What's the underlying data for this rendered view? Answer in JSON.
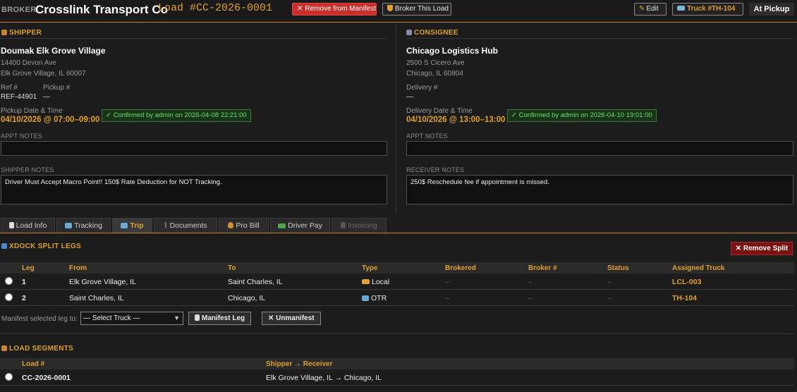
{
  "header": {
    "broker_tag": "BROKER",
    "company": "Crosslink Transport Co",
    "load_id": "Load #CC-2026-0001",
    "remove_manifest_label": "Remove from Manifest",
    "broker_load_label": "Broker This Load",
    "edit_label": "Edit",
    "truck_label": "Truck #TH-104",
    "status": "At Pickup"
  },
  "shipper": {
    "heading": "SHIPPER",
    "name": "Doumak Elk Grove Village",
    "address1": "14400 Devon Ave",
    "address2": "Elk Grove Village, IL 60007",
    "ref_label": "Ref #",
    "ref_value": "REF-44901",
    "pickup_label": "Pickup #",
    "pickup_value": "—",
    "date_label": "Pickup Date & Time",
    "date_value": "04/10/2026 @ 07:00–09:00",
    "confirmed": "✓ Confirmed by admin on 2026-04-08 22:21:00",
    "appt_notes_label": "APPT NOTES",
    "appt_notes": "",
    "notes_label": "SHIPPER NOTES",
    "notes": "Driver Must Accept Macro Point!! 150$ Rate Deduction for NOT Tracking."
  },
  "consignee": {
    "heading": "CONSIGNEE",
    "name": "Chicago Logistics Hub",
    "address1": "2500 S Cicero Ave",
    "address2": "Chicago, IL 60804",
    "delivery_label": "Delivery #",
    "delivery_value": "—",
    "date_label": "Delivery Date & Time",
    "date_value": "04/10/2026 @ 13:00–13:00",
    "confirmed": "✓ Confirmed by admin on 2026-04-10 19:01:00",
    "appt_notes_label": "APPT NOTES",
    "appt_notes": "",
    "notes_label": "RECEIVER NOTES",
    "notes": "250$ Reschedule fee if appointment is missed."
  },
  "tabs": [
    {
      "label": "Load Info",
      "icon": "clipboard-icon"
    },
    {
      "label": "Tracking",
      "icon": "map-icon"
    },
    {
      "label": "Trip",
      "icon": "trip-icon",
      "active": true
    },
    {
      "label": "Documents",
      "icon": "paperclip-icon"
    },
    {
      "label": "Pro Bill",
      "icon": "money-bag-icon"
    },
    {
      "label": "Driver Pay",
      "icon": "cash-icon"
    },
    {
      "label": "Invoicing",
      "icon": "invoice-icon",
      "disabled": true
    }
  ],
  "xdock": {
    "title": "XDOCK SPLIT LEGS",
    "remove_split_label": "✕ Remove Split",
    "columns": [
      "Leg",
      "From",
      "To",
      "Type",
      "Brokered",
      "Broker #",
      "Status",
      "Assigned Truck"
    ],
    "legs": [
      {
        "leg": "1",
        "from": "Elk Grove Village, IL",
        "to": "Saint Charles, IL",
        "type": "Local",
        "type_icon": "truck-icon",
        "brokered": "–",
        "broker_no": "–",
        "status": "–",
        "truck": "LCL-003"
      },
      {
        "leg": "2",
        "from": "Saint Charles, IL",
        "to": "Chicago, IL",
        "type": "OTR",
        "type_icon": "map-icon",
        "brokered": "–",
        "broker_no": "–",
        "status": "–",
        "truck": "TH-104"
      }
    ],
    "manifest_label": "Manifest selected leg to:",
    "select_value": "— Select Truck —",
    "manifest_leg_label": "Manifest Leg",
    "unmanifest_label": "✕ Unmanifest"
  },
  "segments": {
    "title": "LOAD SEGMENTS",
    "columns": [
      "Load #",
      "Shipper → Receiver"
    ],
    "rows": [
      {
        "load": "CC-2026-0001",
        "route": "Elk Grove Village, IL → Chicago, IL"
      }
    ]
  },
  "colors": {
    "accent": "#e0a032",
    "confirm_green": "#6ee06e",
    "danger": "#c9302c"
  }
}
